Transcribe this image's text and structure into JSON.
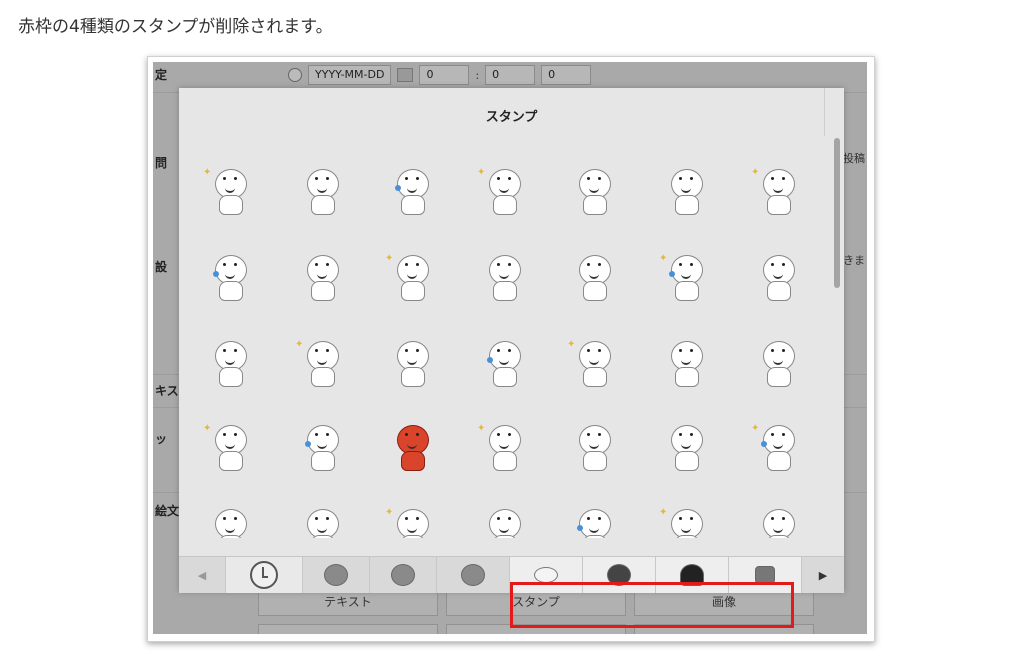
{
  "caption": "赤枠の4種類のスタンプが削除されます。",
  "background_form": {
    "left_labels": [
      "定",
      "問",
      "設",
      "キス",
      "ッ",
      "絵文"
    ],
    "right_labels": [
      "投稿",
      "きま"
    ],
    "date_placeholder": "YYYY-MM-DD",
    "hour_value": "0",
    "minute_value": "0",
    "second_value": "0",
    "time_separator": ":",
    "buttons": [
      "テキスト",
      "スタンプ",
      "画像"
    ]
  },
  "dialog": {
    "title": "スタンプ",
    "stamps_rows": 5,
    "stamps_per_row": 7
  },
  "tabbar": {
    "prev_arrow": "◀",
    "next_arrow": "▶",
    "tabs": [
      {
        "icon": "history-clock-icon"
      },
      {
        "icon": "brown-bear-icon"
      },
      {
        "icon": "cony-icon"
      },
      {
        "icon": "sally-icon"
      },
      {
        "icon": "moon-icon",
        "highlighted": true
      },
      {
        "icon": "brown-face-icon",
        "highlighted": true
      },
      {
        "icon": "james-hair-icon",
        "highlighted": true
      },
      {
        "icon": "thumbs-up-icon",
        "highlighted": true
      }
    ]
  },
  "colors": {
    "highlight": "#e21a1a",
    "overlay": "#a9a9a9",
    "dialog_bg": "#e6e6e6"
  }
}
